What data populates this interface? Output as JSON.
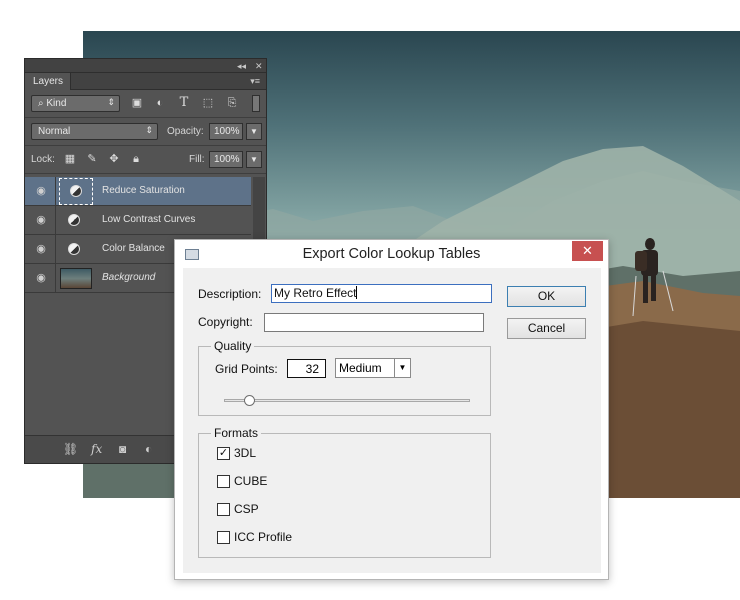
{
  "layers_panel": {
    "tab_label": "Layers",
    "filter_kind": "Kind",
    "blend_mode": "Normal",
    "opacity_label": "Opacity:",
    "opacity_value": "100%",
    "lock_label": "Lock:",
    "fill_label": "Fill:",
    "fill_value": "100%",
    "layers": [
      {
        "name": "Reduce Saturation",
        "selected": true
      },
      {
        "name": "Low Contrast Curves",
        "selected": false
      },
      {
        "name": "Color Balance",
        "selected": false
      },
      {
        "name": "Background",
        "selected": false
      }
    ],
    "bottom_fx": "fx"
  },
  "dialog": {
    "title": "Export Color Lookup Tables",
    "close_glyph": "✕",
    "description_label": "Description:",
    "description_value": "My Retro Effect",
    "copyright_label": "Copyright:",
    "copyright_value": "",
    "ok_label": "OK",
    "cancel_label": "Cancel",
    "quality": {
      "group_label": "Quality",
      "grid_points_label": "Grid Points:",
      "grid_points_value": "32",
      "preset_value": "Medium",
      "slider_fraction": 0.1
    },
    "formats": {
      "group_label": "Formats",
      "options": [
        {
          "label": "3DL",
          "checked": true
        },
        {
          "label": "CUBE",
          "checked": false
        },
        {
          "label": "CSP",
          "checked": false
        },
        {
          "label": "ICC Profile",
          "checked": false
        }
      ]
    }
  }
}
